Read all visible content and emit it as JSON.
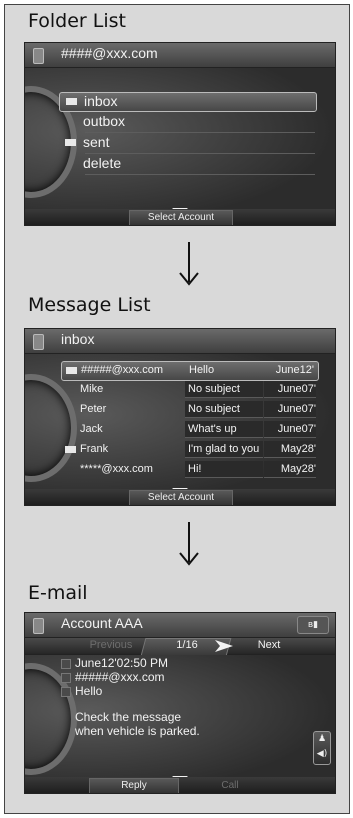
{
  "sections": {
    "folder_list": {
      "heading": "Folder List",
      "account": "####@xxx.com",
      "folders": [
        "inbox",
        "outbox",
        "sent",
        "delete"
      ],
      "bottom_button": "Select Account"
    },
    "message_list": {
      "heading": "Message List",
      "folder": "inbox",
      "messages": [
        {
          "from": "#####@xxx.com",
          "subject": "Hello",
          "date": "June12'"
        },
        {
          "from": "Mike",
          "subject": "No subject",
          "date": "June07'"
        },
        {
          "from": "Peter",
          "subject": "No subject",
          "date": "June07'"
        },
        {
          "from": "Jack",
          "subject": "What's up",
          "date": "June07'"
        },
        {
          "from": "Frank",
          "subject": "I'm glad to you",
          "date": "May28'"
        },
        {
          "from": "*****@xxx.com",
          "subject": "Hi!",
          "date": "May28'"
        }
      ],
      "bottom_button": "Select Account"
    },
    "email": {
      "heading": "E-mail",
      "account": "Account AAA",
      "nav": {
        "previous": "Previous",
        "counter": "1/16",
        "next": "Next"
      },
      "date": "June12'02:50 PM",
      "from": "#####@xxx.com",
      "subject": "Hello",
      "body_line1": "Check the message",
      "body_line2": "when vehicle is parked.",
      "buttons": {
        "reply": "Reply",
        "call": "Call"
      }
    }
  },
  "icons": {
    "envelope": "envelope-icon",
    "phone": "phone-icon",
    "arrow": "down-arrow-icon",
    "bluetooth_signal": "bluetooth-signal-icon"
  },
  "colors": {
    "screen_bg": "#3b3b3b",
    "text": "#f2f2f2",
    "disabled": "#7a7a7a",
    "panel_bg": "#d9d9d9"
  }
}
